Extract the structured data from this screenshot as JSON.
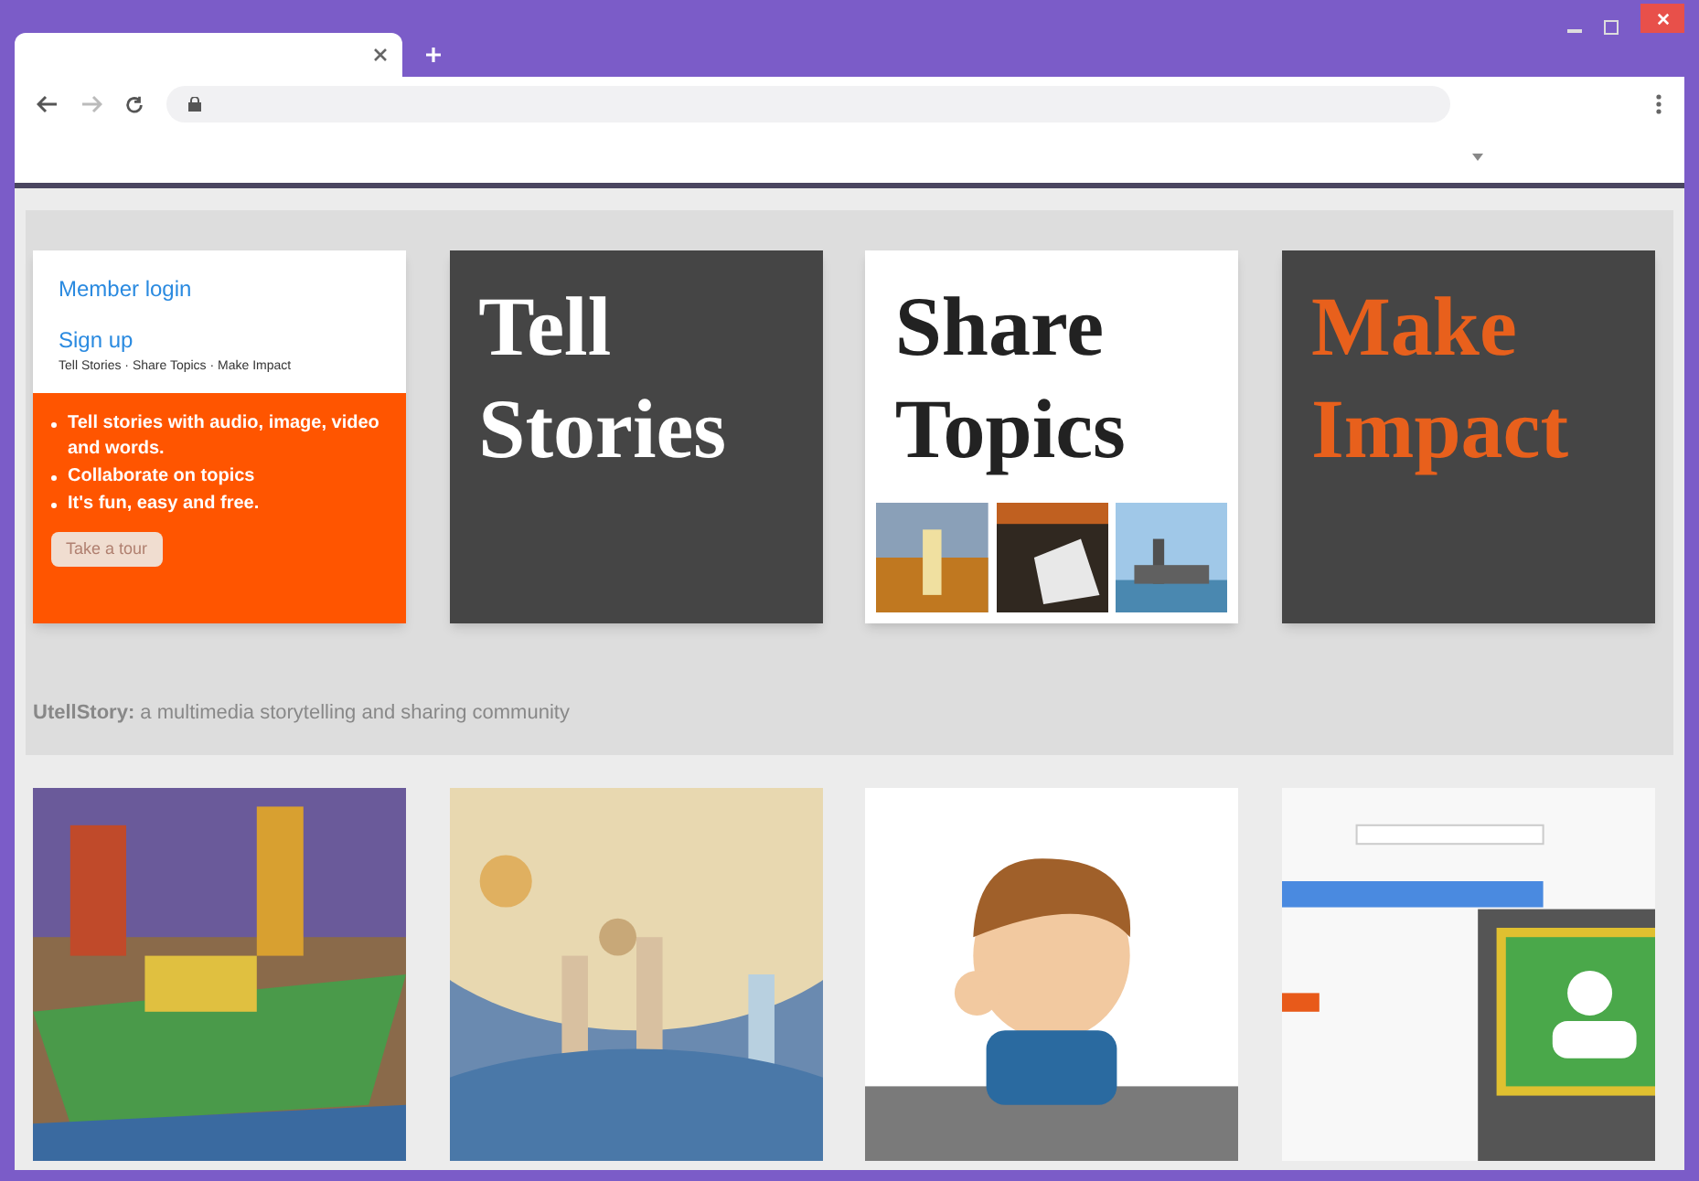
{
  "browser": {
    "tabs": [
      {
        "selected": true
      }
    ]
  },
  "intro": {
    "links": [
      "Member login",
      "Sign up"
    ],
    "nav": "Tell Stories · Share Topics · Make Impact",
    "bullets": [
      "Tell stories with audio, image, video and words.",
      "Collaborate on topics",
      "It's fun, easy and free."
    ],
    "button": "Take a tour"
  },
  "tiles": [
    {
      "kind": "headline",
      "dark": true,
      "color": "#ffffff",
      "lines": [
        "Tell",
        "Stories"
      ]
    },
    {
      "kind": "photos",
      "dark": false,
      "color": "#222222",
      "lines": [
        "Share",
        "Topics"
      ],
      "photos": [
        {
          "kind": "picture"
        },
        {
          "kind": "picture"
        },
        {
          "kind": "picture"
        }
      ]
    },
    {
      "kind": "headline",
      "dark": true,
      "color": "#e8601c",
      "lines": [
        "Make",
        "Impact"
      ]
    }
  ],
  "tagline": "**UtellStory:** a multimedia storytelling and sharing community",
  "gallery": [
    {
      "kind": "picture"
    },
    {
      "kind": "picture"
    },
    {
      "kind": "picture"
    },
    {
      "kind": "picture"
    }
  ]
}
